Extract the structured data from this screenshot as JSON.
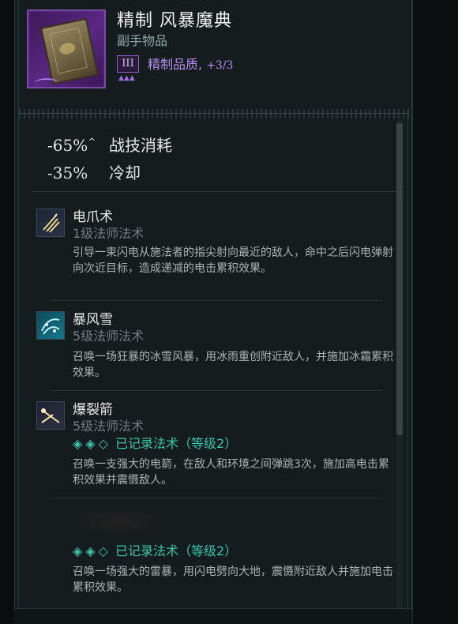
{
  "item": {
    "title": "精制 风暴魔典",
    "type": "副手物品",
    "quality_tier": "III",
    "quality_label": "精制品质,",
    "quality_count": "+3/3",
    "quality_dots": "▲▲▲"
  },
  "stats": [
    {
      "value": "-65%",
      "mark": "^",
      "name": "战技消耗"
    },
    {
      "value": "-35%",
      "mark": "",
      "name": "冷却"
    }
  ],
  "skills": [
    {
      "name": "电爪术",
      "level": "1级法师法术",
      "icon": "lightning-claw-icon",
      "description": "引导一束闪电从施法者的指尖射向最近的敌人，命中之后闪电弹射向次近目标，造成递减的电击累积效果。"
    },
    {
      "name": "暴风雪",
      "level": "5级法师法术",
      "icon": "blizzard-icon",
      "description": "召唤一场狂暴的冰雪风暴，用冰雨重创附近敌人，并施加冰霜累积效果。"
    },
    {
      "name": "爆裂箭",
      "level": "5级法师法术",
      "icon": "burst-arrow-icon",
      "record": {
        "diamonds": "◈◈◇",
        "label": "已记录法术（等级2）"
      },
      "description": "召唤一支强大的电箭，在敌人和环境之间弹跳3次，施加高电击累积效果并震慑敌人。"
    },
    {
      "record": {
        "diamonds": "◈◈◇",
        "label": "已记录法术（等级2）"
      },
      "description": "召唤一场强大的雷暴，用闪电劈向大地，震慑附近敌人并施加电击累积效果。"
    }
  ],
  "colors": {
    "accent": "#39c4ad",
    "quality": "#b98df4",
    "panel": "#151c1e"
  }
}
